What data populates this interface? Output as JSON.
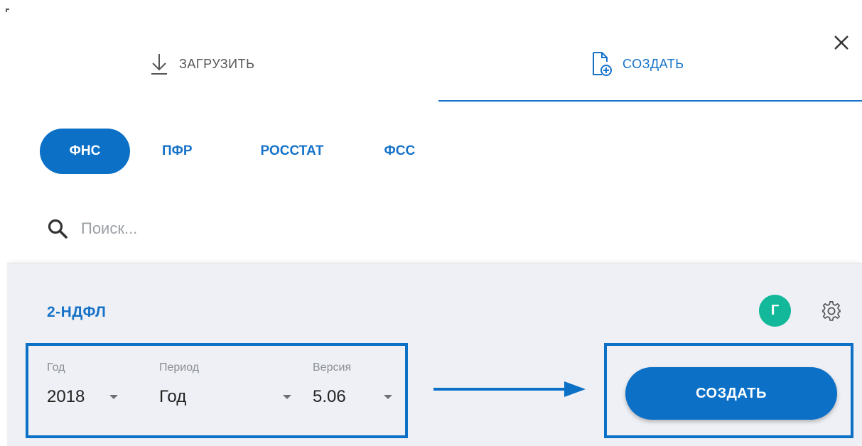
{
  "tabs": {
    "upload": {
      "label": "ЗАГРУЗИТЬ"
    },
    "create": {
      "label": "СОЗДАТЬ"
    }
  },
  "categories": [
    {
      "label": "ФНС",
      "active": true
    },
    {
      "label": "ПФР",
      "active": false
    },
    {
      "label": "РОССТАТ",
      "active": false
    },
    {
      "label": "ФСС",
      "active": false
    }
  ],
  "search": {
    "placeholder": "Поиск..."
  },
  "report": {
    "title": "2-НДФЛ",
    "avatar_letter": "Г",
    "fields": {
      "year": {
        "label": "Год",
        "value": "2018"
      },
      "period": {
        "label": "Период",
        "value": "Год"
      },
      "version": {
        "label": "Версия",
        "value": "5.06"
      }
    },
    "create_button": "СОЗДАТЬ"
  },
  "colors": {
    "accent": "#0b70c6",
    "link": "#1773c8",
    "avatar": "#13b89a",
    "card_bg": "#eef0f5"
  },
  "icons": {
    "upload": "download-arrow-icon",
    "create": "file-add-icon",
    "close": "close-icon",
    "search": "search-icon",
    "settings": "gear-icon"
  }
}
